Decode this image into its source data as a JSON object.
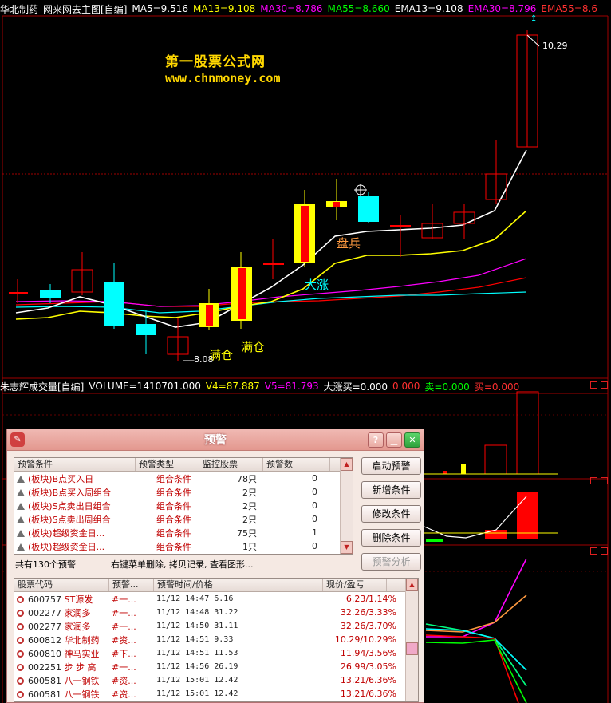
{
  "main_chart": {
    "stock_name": "华北制药",
    "indicator_title": "网来网去主图[自编]",
    "ma5": "MA5=9.516",
    "ma13": "MA13=9.108",
    "ma30": "MA30=8.786",
    "ma55": "MA55=8.660",
    "ema13": "EMA13=9.108",
    "ema30": "EMA30=8.796",
    "ema55": "EMA55=8.6",
    "watermark_title": "第一股票公式网",
    "watermark_url": "www.chnmoney.com",
    "high_label": "10.29",
    "low_label": "8.08",
    "signal_full_pos_1": "满仓",
    "signal_full_pos_2": "满仓",
    "signal_big_rise": "大涨",
    "signal_sell": "盘兵",
    "colors": {
      "up": "#ff0000",
      "down": "#00ffff",
      "ma5": "#ffffff",
      "ma13": "#ffff00",
      "ma30": "#ff00ff",
      "ma55": "#ff0000",
      "ema": "#00ffff"
    }
  },
  "volume_panel": {
    "title": "朱志辉成交量[自编]",
    "volume": "VOLUME=1410701.000",
    "v4": "V4=87.887",
    "v5": "V5=81.793",
    "big_rise_buy": "大涨买=0.000",
    "extra_val": "0.000",
    "sell": "卖=0.000",
    "buy": "买=0.000"
  },
  "alert_dialog": {
    "title": "预警",
    "conditions_headers": [
      "预警条件",
      "预警类型",
      "监控股票",
      "预警数"
    ],
    "conditions": [
      {
        "name": "(板块)B点买入日",
        "type": "组合条件",
        "stocks": "78只",
        "count": "0"
      },
      {
        "name": "(板块)B点买入周组合",
        "type": "组合条件",
        "stocks": "2只",
        "count": "0"
      },
      {
        "name": "(板块)S点卖出日组合",
        "type": "组合条件",
        "stocks": "2只",
        "count": "0"
      },
      {
        "name": "(板块)S点卖出周组合",
        "type": "组合条件",
        "stocks": "2只",
        "count": "0"
      },
      {
        "name": "(板块)超级资金日...",
        "type": "组合条件",
        "stocks": "75只",
        "count": "1"
      },
      {
        "name": "(板块)超级资金日...",
        "type": "组合条件",
        "stocks": "1只",
        "count": "0"
      }
    ],
    "buttons": {
      "start": "启动预警",
      "add": "新增条件",
      "edit": "修改条件",
      "delete": "删除条件",
      "analyze": "预警分析"
    },
    "status_count": "共有130个预警",
    "status_hint": "右键菜单删除, 拷贝记录, 查看图形...",
    "records_headers": [
      "股票代码",
      "预警...",
      "预警时间/价格",
      "现价/盈亏"
    ],
    "records": [
      {
        "code": "600757",
        "name": "ST源发",
        "cond": "#一...",
        "time": "11/12 14:47",
        "price": "6.16",
        "now": "6.23/1.14%"
      },
      {
        "code": "002277",
        "name": "家润多",
        "cond": "#一...",
        "time": "11/12 14:48",
        "price": "31.22",
        "now": "32.26/3.33%"
      },
      {
        "code": "002277",
        "name": "家润多",
        "cond": "#一...",
        "time": "11/12 14:50",
        "price": "31.11",
        "now": "32.26/3.70%"
      },
      {
        "code": "600812",
        "name": "华北制药",
        "cond": "#资...",
        "time": "11/12 14:51",
        "price": "9.33",
        "now": "10.29/10.29%"
      },
      {
        "code": "600810",
        "name": "神马实业",
        "cond": "#下...",
        "time": "11/12 14:51",
        "price": "11.53",
        "now": "11.94/3.56%"
      },
      {
        "code": "002251",
        "name": "步 步 高",
        "cond": "#一...",
        "time": "11/12 14:56",
        "price": "26.19",
        "now": "26.99/3.05%"
      },
      {
        "code": "600581",
        "name": "八一钢铁",
        "cond": "#资...",
        "time": "11/12 15:01",
        "price": "12.42",
        "now": "13.21/6.36%"
      },
      {
        "code": "600581",
        "name": "八一钢铁",
        "cond": "#资...",
        "time": "11/12 15:01",
        "price": "12.42",
        "now": "13.21/6.36%"
      }
    ]
  }
}
